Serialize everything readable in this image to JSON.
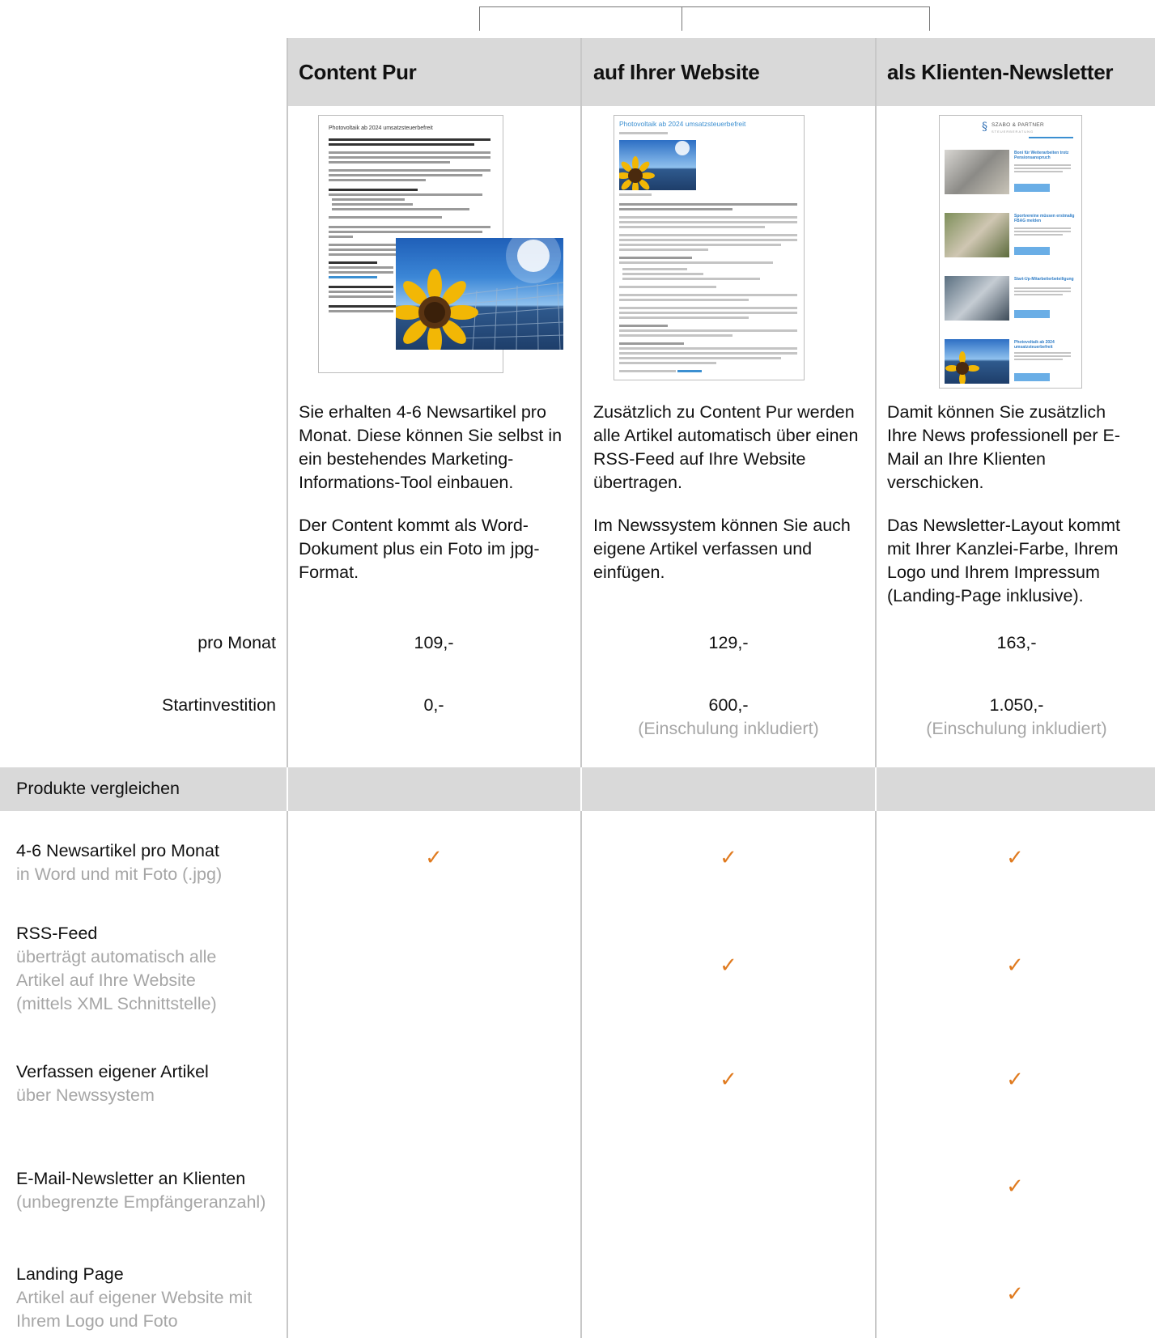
{
  "columns": [
    {
      "title": "Content Pur",
      "paragraphs": [
        "Sie erhalten 4-6 Newsartikel pro Monat. Diese können Sie selbst in ein bestehendes Marketing-Informations-Tool einbauen.",
        "Der Content kommt als Word-Dokument plus ein Foto im jpg-Format."
      ],
      "price_month": "109,-",
      "price_start": "0,-",
      "price_start_note": ""
    },
    {
      "title": "auf Ihrer Website",
      "paragraphs": [
        "Zusätzlich zu Content Pur werden alle Artikel automatisch über einen RSS-Feed auf Ihre Website übertragen.",
        "Im Newssystem können Sie auch eigene Artikel verfassen und einfügen."
      ],
      "price_month": "129,-",
      "price_start": "600,-",
      "price_start_note": "(Einschulung inkludiert)"
    },
    {
      "title": "als Klienten-Newsletter",
      "paragraphs": [
        "Damit können Sie zusätzlich Ihre News professionell per E-Mail an Ihre Klienten verschicken.",
        "Das Newsletter-Layout kommt mit Ihrer Kanzlei-Farbe, Ihrem Logo und Ihrem Impressum (Landing-Page inklusive)."
      ],
      "price_month": "163,-",
      "price_start": "1.050,-",
      "price_start_note": "(Einschulung inkludiert)"
    }
  ],
  "row_labels": {
    "per_month": "pro Monat",
    "start": "Startinvestition"
  },
  "compare_header": "Produkte vergleichen",
  "features": [
    {
      "title": "4-6 Newsartikel pro Monat",
      "subtitle": "in Word und mit Foto (.jpg)",
      "included": [
        true,
        true,
        true
      ]
    },
    {
      "title": "RSS-Feed",
      "subtitle": "überträgt automatisch alle Artikel auf Ihre Website (mittels XML Schnittstelle)",
      "included": [
        false,
        true,
        true
      ]
    },
    {
      "title": "Verfassen eigener Artikel",
      "subtitle": "über Newssystem",
      "included": [
        false,
        true,
        true
      ]
    },
    {
      "title": "E-Mail-Newsletter an Klienten",
      "subtitle": "(unbegrenzte Empfängeranzahl)",
      "included": [
        false,
        false,
        true
      ]
    },
    {
      "title": "Landing Page",
      "subtitle": "Artikel auf eigener Website mit Ihrem Logo und Foto",
      "included": [
        false,
        false,
        true
      ]
    }
  ],
  "check_symbol": "✓",
  "thumbnails": {
    "doc_title": "Photovoltaik ab 2024 umsatzsteuerbefreit",
    "web_title": "Photovoltaik ab 2024 umsatzsteuerbefreit",
    "newsletter_brand": "SZABO & PARTNER",
    "newsletter_brand_sub": "STEUERBERATUNG",
    "newsletter_items": [
      "Boni für Weiterarbeiten trotz Pensionsanspruch",
      "Sportvereine müssen erstmalig FBAG melden",
      "Start-Up-Mitarbeiterbeteiligung",
      "Photovoltaik ab 2024 umsatzsteuerbefreit"
    ]
  },
  "colors": {
    "header_bg": "#d9d9d9",
    "check": "#e07b20",
    "muted_text": "#a6a6a6",
    "link_blue": "#3b8fd1"
  }
}
